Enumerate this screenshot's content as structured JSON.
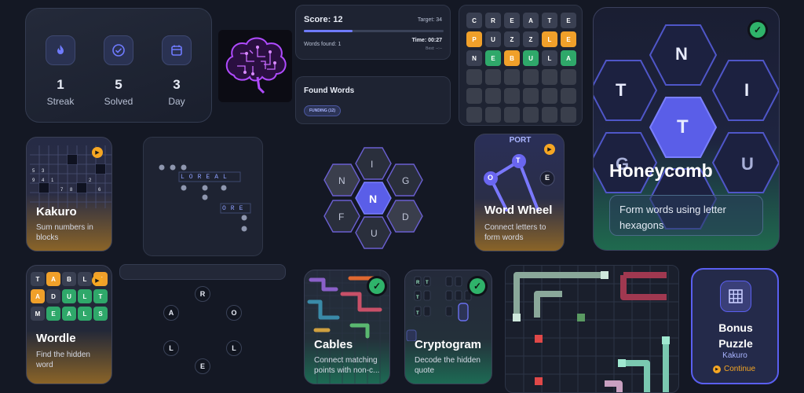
{
  "stats": [
    {
      "value": "1",
      "label": "Streak",
      "icon": "flame-icon"
    },
    {
      "value": "5",
      "label": "Solved",
      "icon": "check-circle-icon"
    },
    {
      "value": "3",
      "label": "Day",
      "icon": "calendar-icon"
    }
  ],
  "score": {
    "label": "Score: 12",
    "target": "Target: 34",
    "words_found": "Words found: 1",
    "time": "Time: 00:27",
    "best": "Best: --:--",
    "progress": 0.35
  },
  "found_words": {
    "title": "Found Words",
    "chip": "FUNDING (12)"
  },
  "letter_grid": {
    "rows": [
      [
        {
          "l": "C",
          "c": "#3a4052"
        },
        {
          "l": "R",
          "c": "#3a4052"
        },
        {
          "l": "E",
          "c": "#3a4052"
        },
        {
          "l": "A",
          "c": "#3a4052"
        },
        {
          "l": "T",
          "c": "#3a4052"
        },
        {
          "l": "E",
          "c": "#3a4052"
        }
      ],
      [
        {
          "l": "P",
          "c": "#f0a02a"
        },
        {
          "l": "U",
          "c": "#3a4052"
        },
        {
          "l": "Z",
          "c": "#3a4052"
        },
        {
          "l": "Z",
          "c": "#3a4052"
        },
        {
          "l": "L",
          "c": "#f0a02a"
        },
        {
          "l": "E",
          "c": "#f0a02a"
        }
      ],
      [
        {
          "l": "N",
          "c": "#3a4052"
        },
        {
          "l": "E",
          "c": "#2fa86a"
        },
        {
          "l": "B",
          "c": "#f0a02a"
        },
        {
          "l": "U",
          "c": "#2fa86a"
        },
        {
          "l": "L",
          "c": "#3a4052"
        },
        {
          "l": "A",
          "c": "#2fa86a"
        }
      ]
    ],
    "empty_rows": 3
  },
  "honeycomb": {
    "title": "Honeycomb",
    "description": "Form words using letter hexagons",
    "center": "T",
    "letters": [
      "N",
      "T",
      "I",
      "G",
      "U",
      "I"
    ]
  },
  "kakuro": {
    "title": "Kakuro",
    "description": "Sum numbers in blocks"
  },
  "word_snippet": {
    "words": [
      "LOREAL",
      "ORE"
    ]
  },
  "hex_mini": {
    "center": "N",
    "outer": [
      "I",
      "G",
      "D",
      "U",
      "F",
      "N"
    ]
  },
  "wordwheel": {
    "title": "Word Wheel",
    "description": "Connect letters to form words",
    "top_word": "PORT",
    "letters": [
      "T",
      "O",
      "E"
    ]
  },
  "wordle": {
    "title": "Wordle",
    "description": "Find the hidden word",
    "rows": [
      [
        {
          "l": "T",
          "c": "#3a4052"
        },
        {
          "l": "A",
          "c": "#f0a02a"
        },
        {
          "l": "B",
          "c": "#3a4052"
        },
        {
          "l": "L",
          "c": "#3a4052"
        },
        {
          "l": "E",
          "c": "#f0a02a"
        }
      ],
      [
        {
          "l": "A",
          "c": "#f0a02a"
        },
        {
          "l": "D",
          "c": "#3a4052"
        },
        {
          "l": "U",
          "c": "#2fa86a"
        },
        {
          "l": "L",
          "c": "#2fa86a"
        },
        {
          "l": "T",
          "c": "#2fa86a"
        }
      ],
      [
        {
          "l": "M",
          "c": "#3a4052"
        },
        {
          "l": "E",
          "c": "#2fa86a"
        },
        {
          "l": "A",
          "c": "#2fa86a"
        },
        {
          "l": "L",
          "c": "#2fa86a"
        },
        {
          "l": "S",
          "c": "#2fa86a"
        }
      ]
    ]
  },
  "anagram": {
    "letters": [
      "R",
      "A",
      "O",
      "L",
      "L",
      "E"
    ]
  },
  "cables": {
    "title": "Cables",
    "description": "Connect matching points with non-c..."
  },
  "cryptogram": {
    "title": "Cryptogram",
    "description": "Decode the hidden quote"
  },
  "bonus": {
    "title": "Bonus Puzzle",
    "subtitle": "Kakuro",
    "action": "Continue"
  },
  "colors": {
    "accent": "#5a5ff0",
    "orange": "#f0a02a",
    "green": "#2fa86a"
  }
}
